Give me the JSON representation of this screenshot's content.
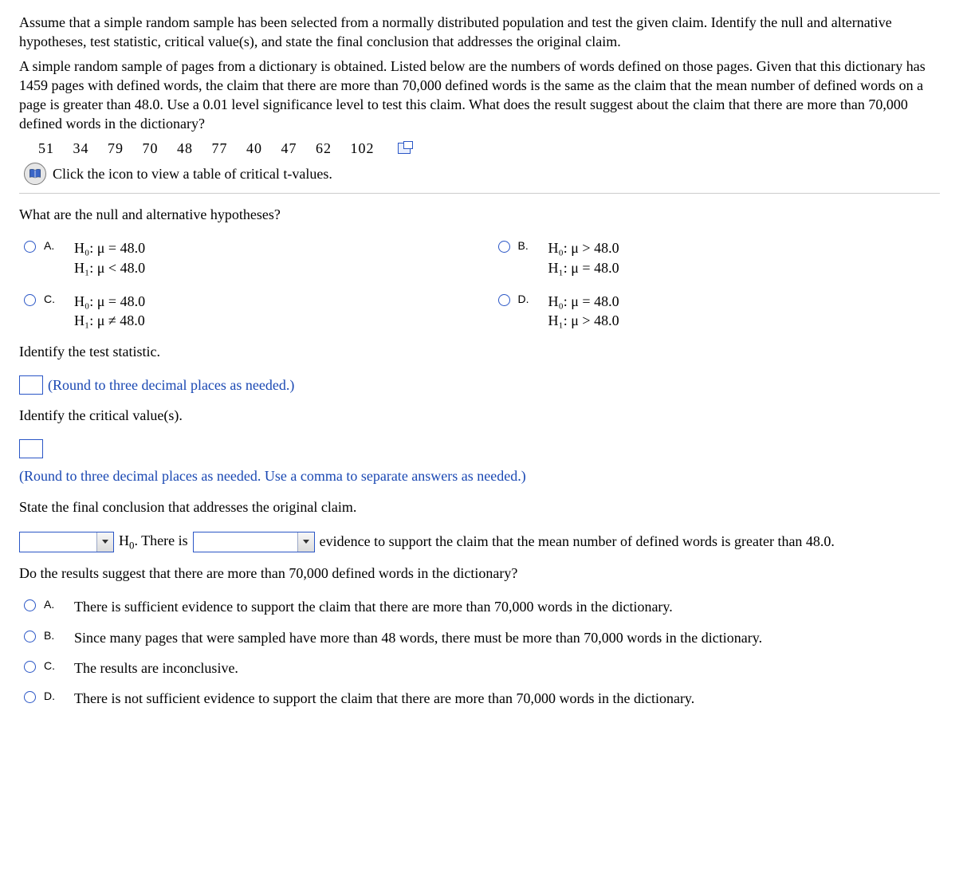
{
  "intro": {
    "para1": "Assume that a simple random sample has been selected from a normally distributed population and test the given claim. Identify the null and alternative hypotheses, test statistic, critical value(s), and state the final conclusion that addresses the original claim.",
    "para2": "A simple random sample of pages from a dictionary is obtained. Listed below are the numbers of words defined on those pages. Given that this dictionary has 1459 pages with defined words, the claim that there are more than 70,000 defined words is the same as the claim that the mean number of defined words on a page is greater than 48.0. Use a 0.01 level significance level to test this claim. What does the result suggest about the claim that there are more than 70,000 defined words in the dictionary?",
    "data_values": "51 34 79 70 48 77 40 47 62 102",
    "link_text": "Click the icon to view a table of critical t-values."
  },
  "q1": {
    "prompt": "What are the null and alternative hypotheses?",
    "options": {
      "A": {
        "label": "A.",
        "h0": "H₀: μ = 48.0",
        "h1": "H₁: μ < 48.0"
      },
      "B": {
        "label": "B.",
        "h0": "H₀: μ > 48.0",
        "h1": "H₁: μ = 48.0"
      },
      "C": {
        "label": "C.",
        "h0": "H₀: μ = 48.0",
        "h1": "H₁: μ ≠ 48.0"
      },
      "D": {
        "label": "D.",
        "h0": "H₀: μ = 48.0",
        "h1": "H₁: μ > 48.0"
      }
    }
  },
  "q2": {
    "prompt": "Identify the test statistic.",
    "hint": "(Round to three decimal places as needed.)"
  },
  "q3": {
    "prompt": "Identify the critical value(s).",
    "hint": "(Round to three decimal places as needed. Use a comma to separate answers as needed.)"
  },
  "q4": {
    "prompt": "State the final conclusion that addresses the original claim.",
    "mid1": "H",
    "mid1_sub": "0",
    "mid2": ". There is",
    "tail": "evidence to support the claim that the mean number of defined words is greater than 48.0."
  },
  "q5": {
    "prompt": "Do the results suggest that there are more than 70,000 defined words in the dictionary?",
    "options": {
      "A": {
        "label": "A.",
        "text": "There is sufficient evidence to support the claim that there are more than 70,000 words in the dictionary."
      },
      "B": {
        "label": "B.",
        "text": "Since many pages that were sampled have more than 48 words, there must be more than 70,000 words in the dictionary."
      },
      "C": {
        "label": "C.",
        "text": "The results are inconclusive."
      },
      "D": {
        "label": "D.",
        "text": "There is not sufficient evidence to support the claim that there are more than 70,000 words in the dictionary."
      }
    }
  }
}
